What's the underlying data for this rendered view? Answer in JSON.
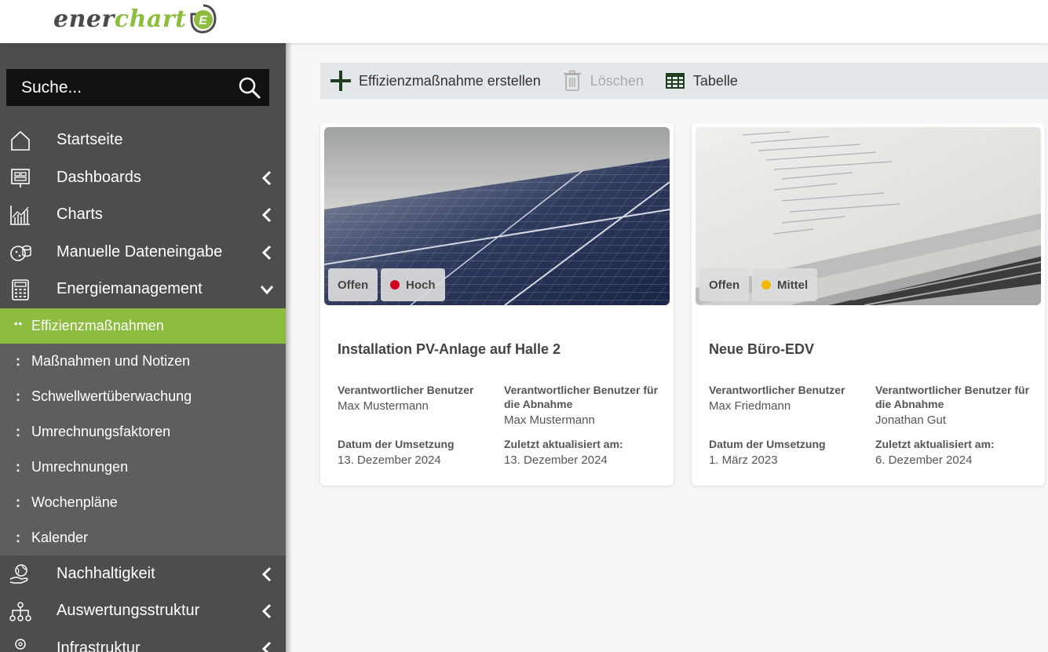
{
  "brand": {
    "part1": "ener",
    "part2": "chart",
    "badge_letter": "E"
  },
  "search": {
    "placeholder": "Suche..."
  },
  "nav": {
    "items": [
      {
        "label": "Startseite",
        "icon": "home-icon"
      },
      {
        "label": "Dashboards",
        "icon": "dashboard-icon"
      },
      {
        "label": "Charts",
        "icon": "chart-icon"
      },
      {
        "label": "Manuelle Dateneingabe",
        "icon": "data-entry-icon"
      },
      {
        "label": "Energiemanagement",
        "icon": "calculator-icon"
      },
      {
        "label": "Nachhaltigkeit",
        "icon": "globe-hand-icon"
      },
      {
        "label": "Auswertungsstruktur",
        "icon": "hierarchy-icon"
      },
      {
        "label": "Infrastruktur",
        "icon": "infrastructure-icon"
      }
    ],
    "subitems": [
      {
        "label": "Effizienzmaßnahmen",
        "marker": "••"
      },
      {
        "label": "Maßnahmen und Notizen",
        "marker": ":"
      },
      {
        "label": "Schwellwertüberwachung",
        "marker": ":"
      },
      {
        "label": "Umrechnungsfaktoren",
        "marker": ":"
      },
      {
        "label": "Umrechnungen",
        "marker": ":"
      },
      {
        "label": "Wochenpläne",
        "marker": ":"
      },
      {
        "label": "Kalender",
        "marker": ":"
      }
    ]
  },
  "toolbar": {
    "create_label": "Effizienzmaßnahme erstellen",
    "delete_label": "Löschen",
    "table_label": "Tabelle"
  },
  "cards": [
    {
      "status": "Offen",
      "priority": "Hoch",
      "priority_color": "#d0021b",
      "title": "Installation PV-Anlage auf Halle 2",
      "responsible_label": "Verantwortlicher Benutzer",
      "responsible": "Max Mustermann",
      "approval_label": "Verantwortlicher Benutzer für die Abnahme",
      "approval": "Max Mustermann",
      "date_label": "Datum der Umsetzung",
      "date": "13. Dezember 2024",
      "updated_label": "Zuletzt aktualisiert am:",
      "updated": "13. Dezember 2024"
    },
    {
      "status": "Offen",
      "priority": "Mittel",
      "priority_color": "#f5b800",
      "title": "Neue Büro-EDV",
      "responsible_label": "Verantwortlicher Benutzer",
      "responsible": "Max Friedmann",
      "approval_label": "Verantwortlicher Benutzer für die Abnahme",
      "approval": "Jonathan Gut",
      "date_label": "Datum der Umsetzung",
      "date": "1. März 2023",
      "updated_label": "Zuletzt aktualisiert am:",
      "updated": "6. Dezember 2024"
    }
  ],
  "colors": {
    "accent": "#8cbd3f",
    "sidebar": "#4d4d4d",
    "submenu": "#5e5e5e"
  }
}
